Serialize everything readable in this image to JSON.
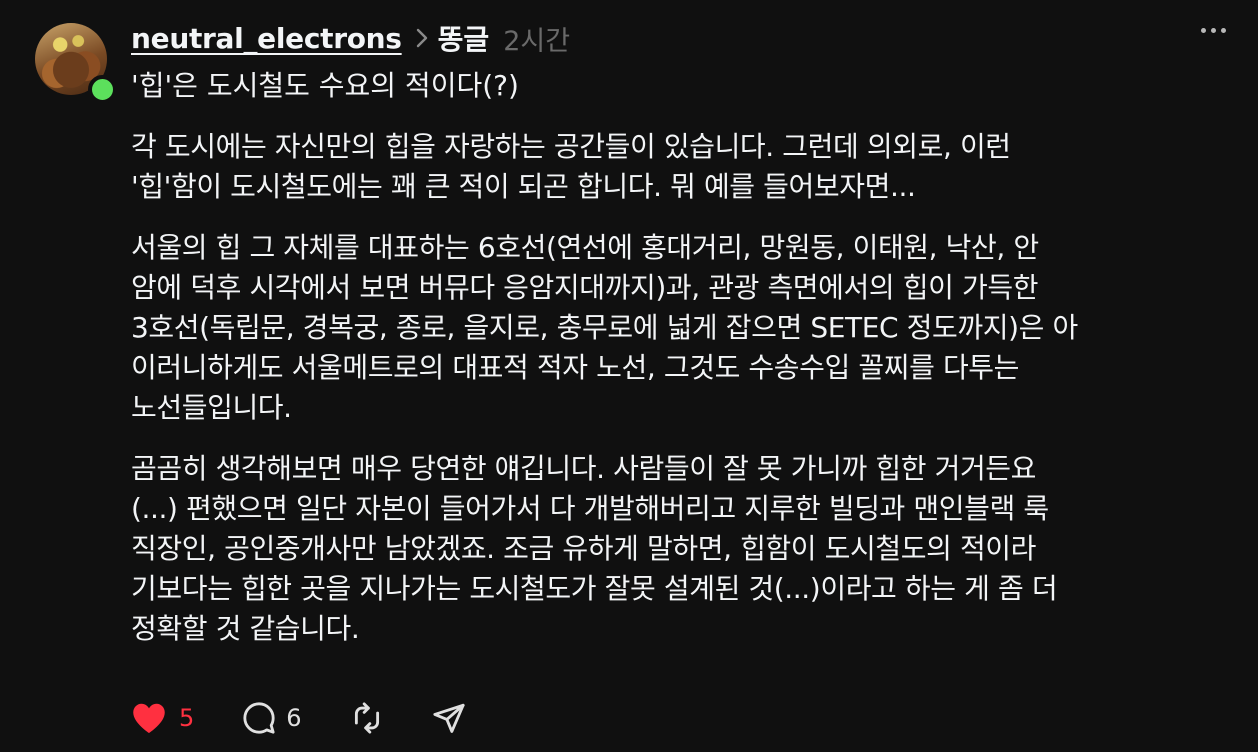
{
  "post": {
    "username": "neutral_electrons",
    "community": "똥글",
    "time_ago": "2시간",
    "title": "'힙'은 도시철도 수요의 적이다(?)",
    "paragraphs": [
      [
        "각 도시에는 자신만의 힙을 자랑하는 공간들이 있습니다. 그런데 의외로, 이런",
        "'힙'함이 도시철도에는 꽤 큰 적이 되곤 합니다. 뭐 예를 들어보자면..."
      ],
      [
        "서울의 힙 그 자체를 대표하는 6호선(연선에 홍대거리, 망원동, 이태원, 낙산, 안",
        "암에 덕후 시각에서 보면 버뮤다 응암지대까지)과, 관광 측면에서의 힙이 가득한",
        "3호선(독립문, 경복궁, 종로, 을지로, 충무로에 넓게 잡으면 SETEC 정도까지)은 아",
        "이러니하게도 서울메트로의 대표적 적자 노선, 그것도 수송수입 꼴찌를 다투는",
        "노선들입니다."
      ],
      [
        "곰곰히 생각해보면 매우 당연한 얘깁니다. 사람들이 잘 못 가니까 힙한 거거든요",
        "(...) 편했으면 일단 자본이 들어가서 다 개발해버리고 지루한 빌딩과 맨인블랙 룩",
        "직장인, 공인중개사만 남았겠죠. 조금 유하게 말하면, 힙함이 도시철도의 적이라",
        "기보다는 힙한 곳을 지나가는 도시철도가 잘못 설계된 것(...)이라고 하는 게 좀 더",
        "정확할 것 같습니다."
      ]
    ]
  },
  "actions": {
    "like_count": "5",
    "reply_count": "6",
    "like_icon": "heart-filled-icon",
    "reply_icon": "speech-bubble-icon",
    "repost_icon": "repost-icon",
    "share_icon": "paper-plane-icon"
  },
  "colors": {
    "background": "#101010",
    "text": "#f3f5f7",
    "muted": "#6a6a6a",
    "like": "#ff3040",
    "online": "#5ce05c"
  }
}
